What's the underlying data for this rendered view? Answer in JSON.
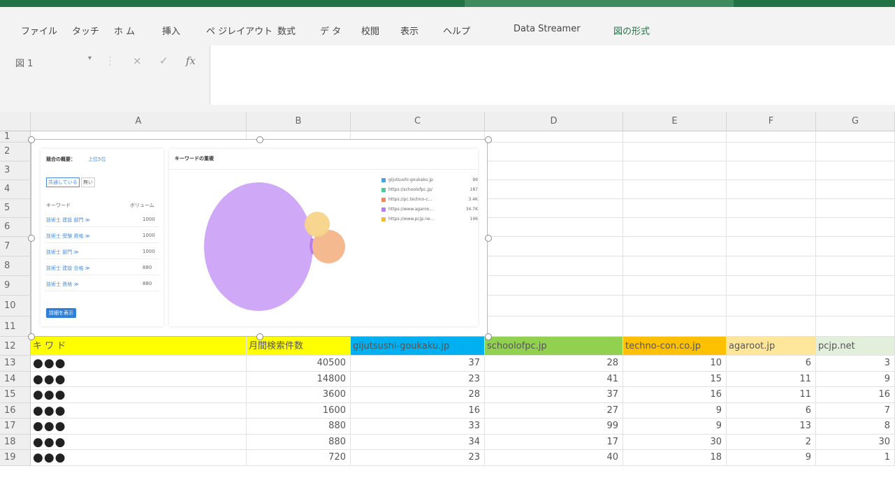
{
  "ribbon_tabs": [
    "ファイル",
    "タッチ",
    "ホ ム",
    "挿入",
    "ペ ジレイアウト",
    "数式",
    "デ タ",
    "校閲",
    "表示",
    "ヘルプ",
    "Data Streamer",
    "図の形式"
  ],
  "namebox": {
    "value": "図 1"
  },
  "formula_icons": {
    "cancel": "×",
    "enter": "✓",
    "fx": "fx"
  },
  "columns": [
    "A",
    "B",
    "C",
    "D",
    "E",
    "F",
    "G"
  ],
  "rows": [
    "1",
    "2",
    "3",
    "4",
    "5",
    "6",
    "7",
    "8",
    "9",
    "10",
    "11",
    "12",
    "13",
    "14",
    "15",
    "16",
    "17",
    "18",
    "19"
  ],
  "header_row": {
    "keyword": "キ ワ ド",
    "search_volume": "月間検索件数",
    "domains": [
      "gijutsushi-goukaku.jp",
      "schoolofpc.jp",
      "techno-con.co.jp",
      "agaroot.jp",
      "pcjp.net"
    ],
    "colors": [
      "#ffff00",
      "#ffff00",
      "#00b0f0",
      "#92d050",
      "#ffc000",
      "#ffe699",
      "#e2efda"
    ]
  },
  "data_rows": [
    {
      "kw": "●●●",
      "vol": "40500",
      "v": [
        "37",
        "28",
        "10",
        "6",
        "3"
      ]
    },
    {
      "kw": "●●●",
      "vol": "14800",
      "v": [
        "23",
        "41",
        "15",
        "11",
        "9"
      ]
    },
    {
      "kw": "●●●",
      "vol": "3600",
      "v": [
        "28",
        "37",
        "16",
        "11",
        "16"
      ]
    },
    {
      "kw": "●●●",
      "vol": "1600",
      "v": [
        "16",
        "27",
        "9",
        "6",
        "7"
      ]
    },
    {
      "kw": "●●●",
      "vol": "880",
      "v": [
        "33",
        "99",
        "9",
        "13",
        "8"
      ]
    },
    {
      "kw": "●●●",
      "vol": "880",
      "v": [
        "34",
        "17",
        "30",
        "2",
        "30"
      ]
    },
    {
      "kw": "●●●",
      "vol": "720",
      "v": [
        "23",
        "40",
        "18",
        "9",
        "1"
      ]
    }
  ],
  "embedded_chart": {
    "left_panel": {
      "title": "競合の概要：",
      "badge": "上位5位",
      "tabs": [
        "共通している",
        "無い"
      ],
      "col_headers": [
        "キーワード",
        "ボリューム"
      ],
      "rows": [
        {
          "kw": "技術士 建設 部門 ≫",
          "vol": "1000"
        },
        {
          "kw": "技術士 受験 資格 ≫",
          "vol": "1000"
        },
        {
          "kw": "技術士 部門 ≫",
          "vol": "1000"
        },
        {
          "kw": "技術士 建設 合格 ≫",
          "vol": "880"
        },
        {
          "kw": "技術士 資格 ≫",
          "vol": "880"
        }
      ],
      "button": "詳細を表示"
    },
    "right_panel": {
      "title": "キーワードの重複",
      "legend": [
        {
          "name": "gijutsushi-goukaku.jp",
          "val": "99",
          "color": "#4aa3df"
        },
        {
          "name": "https://schoolofpc.jp/",
          "val": "187",
          "color": "#4ec9a0"
        },
        {
          "name": "https://pc.techno-c...",
          "val": "3.4K",
          "color": "#f0875a"
        },
        {
          "name": "https://www.agaroo...",
          "val": "34.7K",
          "color": "#b57ee8"
        },
        {
          "name": "https://www.pcjp.ne...",
          "val": "196",
          "color": "#f6b83b"
        }
      ],
      "circle_colors": {
        "main": "#cfa8f7",
        "orange": "#f4b98f",
        "yellow": "#f7d489",
        "purple_edge": "#b57ee8"
      }
    }
  }
}
